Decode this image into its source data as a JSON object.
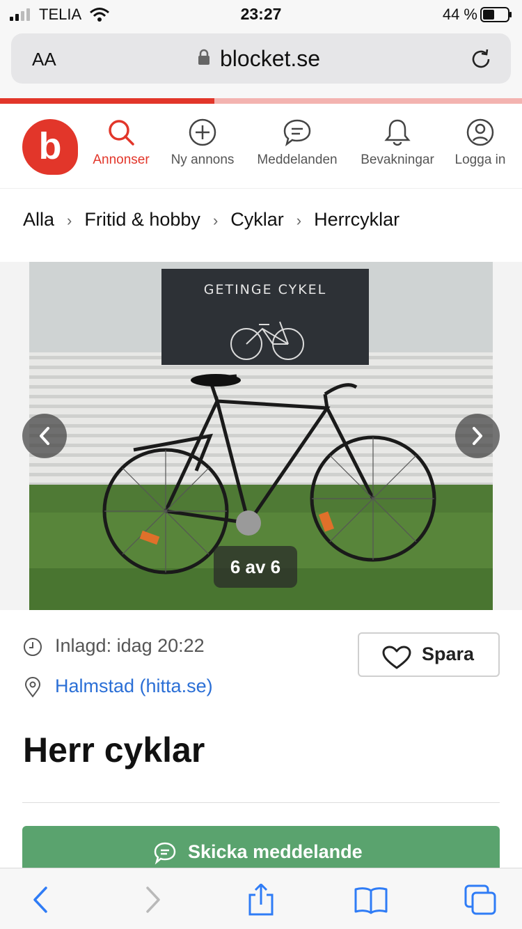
{
  "status_bar": {
    "carrier": "TELIA",
    "time": "23:27",
    "battery_percent": "44 %"
  },
  "browser": {
    "aa_label": "AA",
    "url": "blocket.se",
    "load_progress": 0.41
  },
  "header": {
    "logo_letter": "b",
    "nav": [
      {
        "label": "Annonser",
        "icon": "search-icon",
        "active": true
      },
      {
        "label": "Ny annons",
        "icon": "plus-circle-icon",
        "active": false
      },
      {
        "label": "Meddelanden",
        "icon": "chat-bubble-icon",
        "active": false
      },
      {
        "label": "Bevakningar",
        "icon": "bell-icon",
        "active": false
      },
      {
        "label": "Logga in",
        "icon": "user-circle-icon",
        "active": false
      }
    ]
  },
  "breadcrumb": [
    "Alla",
    "Fritid & hobby",
    "Cyklar",
    "Herrcyklar"
  ],
  "gallery": {
    "counter": "6 av 6",
    "sign_text": "GETINGE CYKEL"
  },
  "listing": {
    "posted": "Inlagd: idag 20:22",
    "location": "Halmstad (hitta.se)",
    "save_label": "Spara",
    "title": "Herr cyklar",
    "send_message_label": "Skicka meddelande"
  },
  "colors": {
    "brand_red": "#e2362a",
    "link_blue": "#2b6fd6",
    "button_green": "#5aa36e",
    "ios_blue": "#2f7cf6"
  }
}
